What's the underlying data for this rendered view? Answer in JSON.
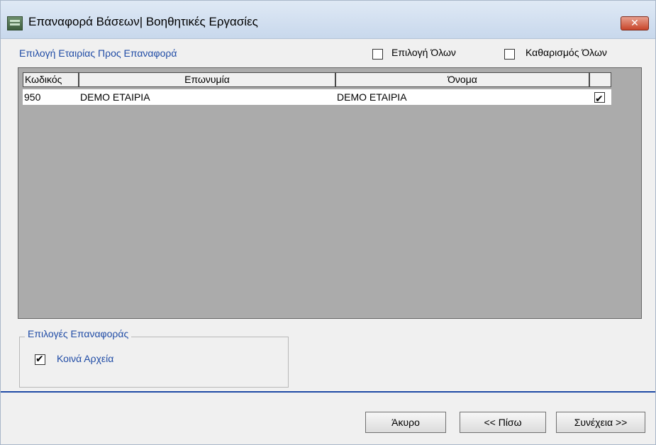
{
  "window": {
    "title": "Επαναφορά Βάσεων| Βοηθητικές Εργασίες",
    "close_label": "✕"
  },
  "selection": {
    "label": "Επιλογή Εταιρίας Προς Επαναφορά",
    "select_all_label": "Επιλογή Όλων",
    "clear_all_label": "Καθαρισμός Όλων"
  },
  "grid": {
    "columns": [
      "Κωδικός",
      "Επωνυμία",
      "Όνομα"
    ],
    "rows": [
      {
        "code": "950",
        "name": "DEMO ΕΤΑΙΡΙΑ",
        "short_name": "DEMO ΕΤΑΙΡΙΑ",
        "checked": true
      }
    ]
  },
  "options": {
    "legend": "Επιλογές Επαναφοράς",
    "common_files_label": "Κοινά Αρχεία",
    "common_files_checked": true
  },
  "buttons": {
    "cancel": "Άκυρο",
    "back": "<< Πίσω",
    "next": "Συνέχεια >>"
  },
  "colors": {
    "accent": "#1f4ba5",
    "grid_background": "#ababab"
  }
}
